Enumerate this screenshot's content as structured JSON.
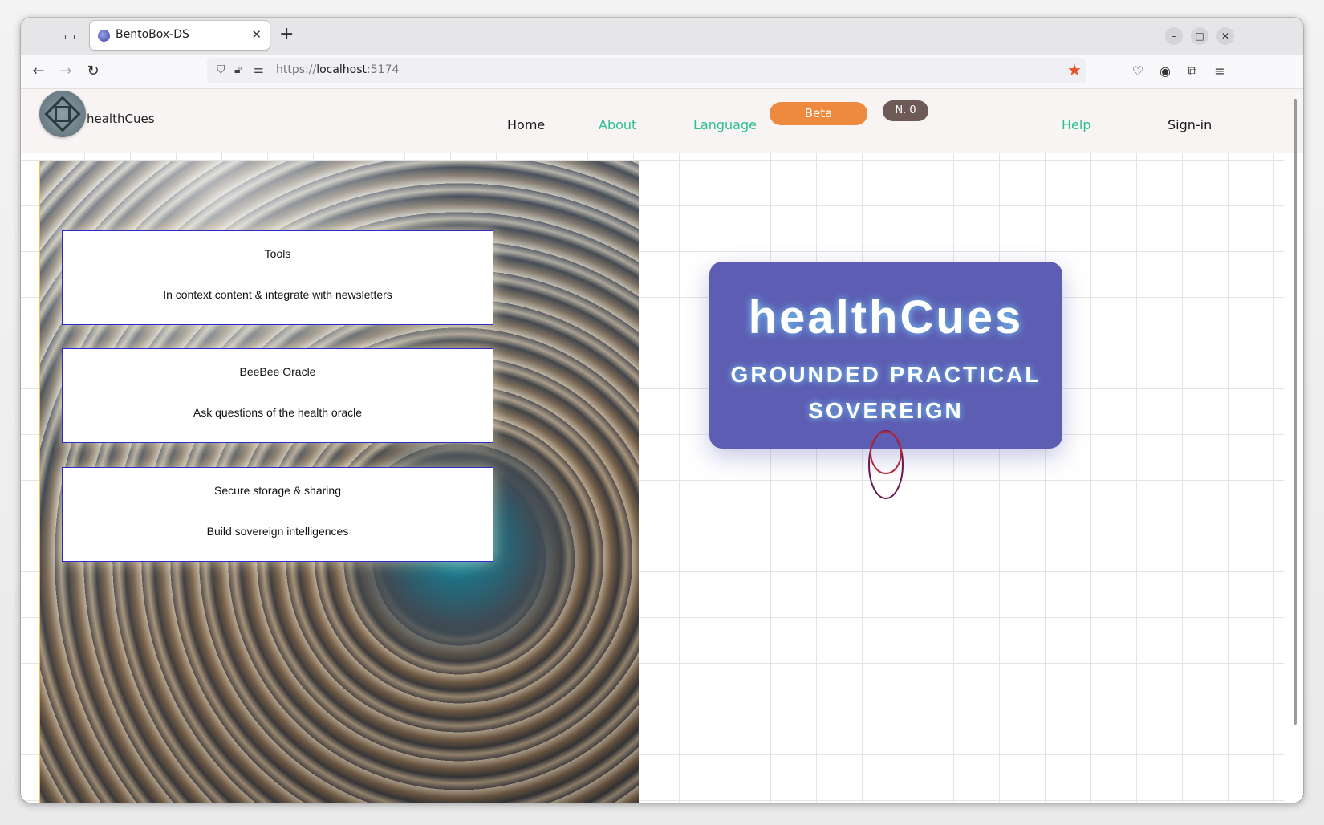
{
  "browser": {
    "tab_title": "BentoBox-DS",
    "tab_close": "✕",
    "new_tab": "+",
    "url_scheme": "https://",
    "url_host": "localhost",
    "url_port": ":5174"
  },
  "site": {
    "brand": "healthCues",
    "nav": {
      "home": "Home",
      "about": "About",
      "language": "Language",
      "beta": "Beta",
      "counter": "N. 0",
      "help": "Help",
      "signin": "Sign-in"
    },
    "colors": {
      "nav_default": "#1a1a1a",
      "nav_accent": "#2bbf8e",
      "beta_pill": "#ee8a3d",
      "counter_pill": "#6e5a57",
      "hero_box": "#5d5eb3",
      "card_border": "#2a2acf"
    }
  },
  "cards": [
    {
      "title": "Tools",
      "desc": "In context content & integrate with newsletters"
    },
    {
      "title": "BeeBee Oracle",
      "desc": "Ask questions of the health oracle"
    },
    {
      "title": "Secure storage & sharing",
      "desc": "Build sovereign intelligences"
    }
  ],
  "hero": {
    "title": "healthCues",
    "subtitle": "GROUNDED PRACTICAL SOVEREIGN"
  }
}
